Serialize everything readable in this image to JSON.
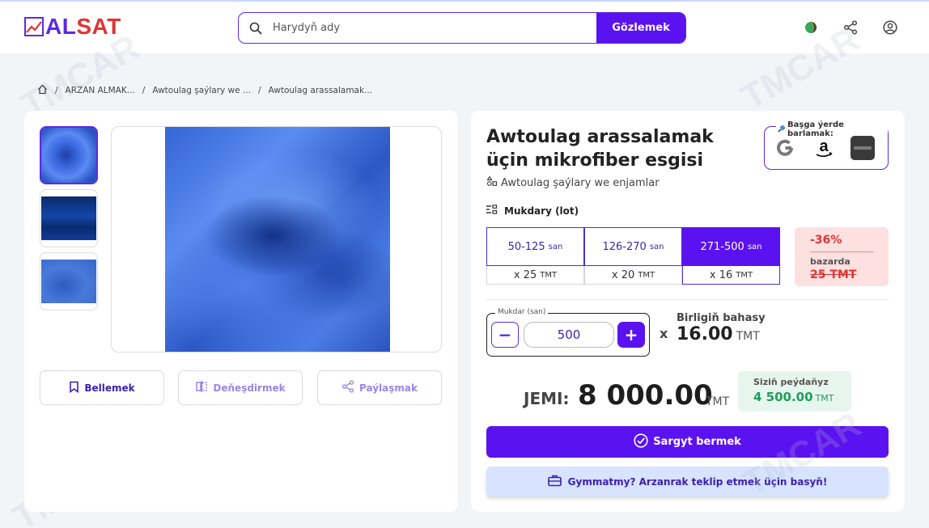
{
  "header": {
    "logo_al": "AL",
    "logo_sat": "SAT",
    "search_placeholder": "Harydyň ady",
    "search_button": "Gözlemek"
  },
  "watermark": "TMCAR",
  "breadcrumb": [
    "ARZAN ALMAK...",
    "Awtoulag şaýlary we ...",
    "Awtoulag arassalamak..."
  ],
  "gallery": {
    "thumbnails": 3,
    "actions": {
      "bookmark": "Bellemek",
      "compare": "Deňeşdirmek",
      "share": "Paýlaşmak"
    }
  },
  "product": {
    "title": "Awtoulag arassalamak üçin mikrofiber esgisi",
    "category": "Awtoulag şaýlary we enjamlar",
    "elsewhere_title": "Başga ýerde barlamak:",
    "quantity_label": "Mukdary (lot)"
  },
  "tiers": [
    {
      "range": "50-125",
      "unit": "san",
      "price": "x 25",
      "currency": "TMT",
      "selected": false
    },
    {
      "range": "126-270",
      "unit": "san",
      "price": "x 20",
      "currency": "TMT",
      "selected": false
    },
    {
      "range": "271-500",
      "unit": "san",
      "price": "x 16",
      "currency": "TMT",
      "selected": true
    }
  ],
  "discount": {
    "percent": "-36%",
    "label": "bazarda",
    "old_price": "25 TMT"
  },
  "quantity": {
    "legend": "Mukdar (san)",
    "value": "500",
    "minus": "−",
    "plus": "+"
  },
  "unit_price": {
    "times": "x",
    "label": "Birligiň bahasy",
    "value": "16.00",
    "currency": "TMT"
  },
  "total": {
    "label": "JEMI:",
    "value": "8 000.00",
    "currency": "TMT"
  },
  "savings": {
    "label": "Siziň peýdaňyz",
    "value": "4 500.00",
    "currency": "TMT"
  },
  "buttons": {
    "order": "Sargyt bermek",
    "offer": "Gymmatmy? Arzanrak teklip etmek üçin basyň!"
  },
  "colors": {
    "brand": "#5b12f0",
    "logo_red": "#e03434",
    "discount_bg": "#fde0e0",
    "savings_green": "#1f9d5a",
    "offer_bg": "#d7e3ff"
  }
}
